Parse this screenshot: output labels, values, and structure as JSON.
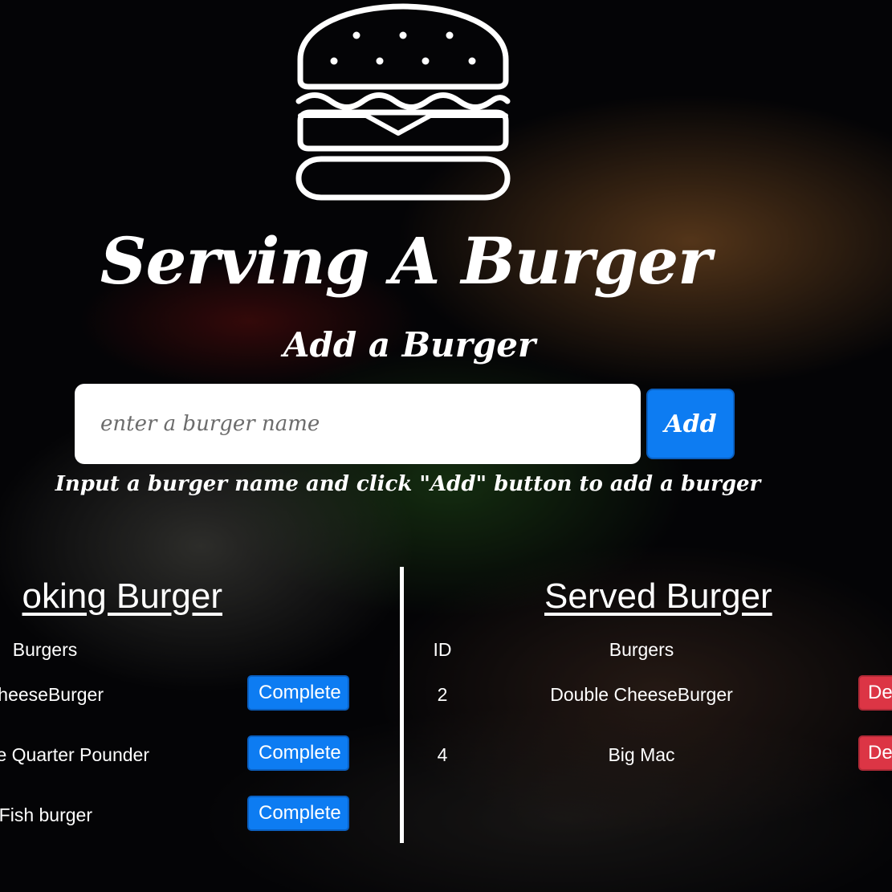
{
  "header": {
    "title": "Serving A Burger",
    "subtitle": "Add a Burger"
  },
  "add_form": {
    "placeholder": "enter a burger name",
    "value": "",
    "add_label": "Add",
    "hint": "Input a burger name and click \"Add\" button to add a burger"
  },
  "cooking": {
    "title": "oking Burger",
    "column_burgers": "Burgers",
    "rows": [
      {
        "name": "heeseBurger",
        "action": "Complete"
      },
      {
        "name": "e Quarter Pounder",
        "action": "Complete"
      },
      {
        "name": "Fish burger",
        "action": "Complete"
      }
    ]
  },
  "served": {
    "title": "Served Burger",
    "column_id": "ID",
    "column_burgers": "Burgers",
    "rows": [
      {
        "id": "2",
        "name": "Double CheeseBurger",
        "action": "De"
      },
      {
        "id": "4",
        "name": "Big Mac",
        "action": "De"
      }
    ]
  },
  "icons": {
    "logo": "burger-icon"
  },
  "colors": {
    "primary": "#0d7cf2",
    "danger": "#dc3545",
    "text": "#ffffff"
  }
}
